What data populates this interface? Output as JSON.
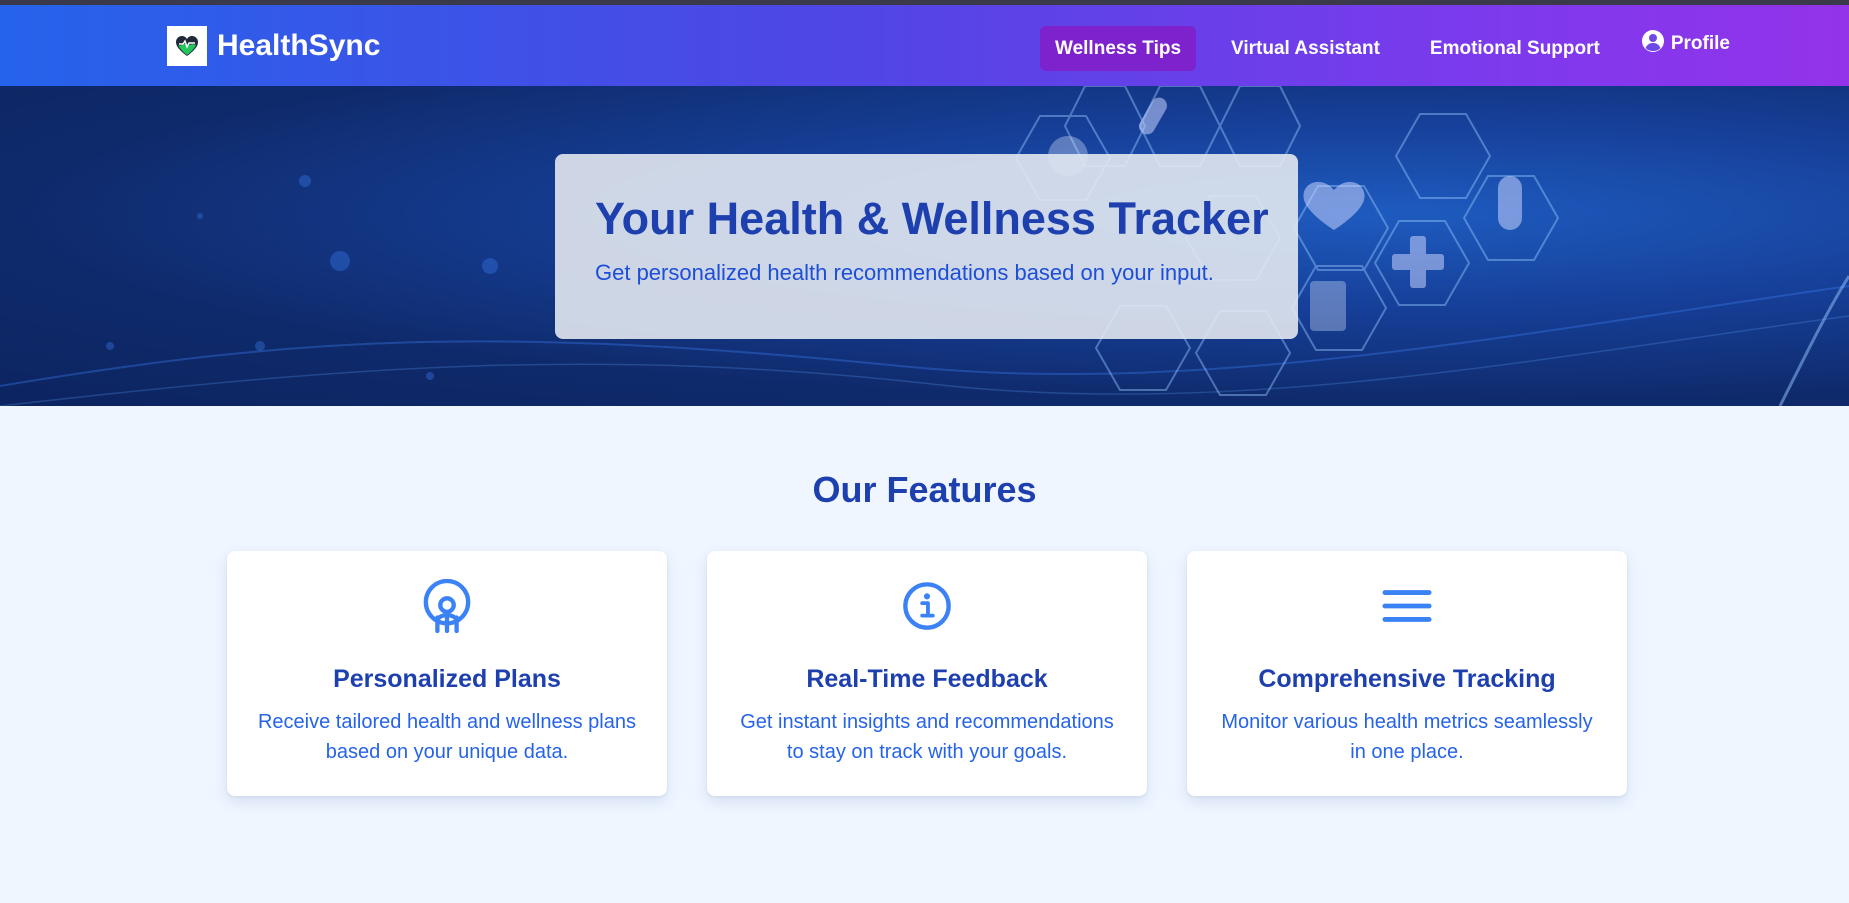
{
  "brand": {
    "name": "HealthSync",
    "logo_icon": "heart-logo-icon"
  },
  "nav": {
    "items": [
      {
        "label": "Wellness Tips",
        "active": true
      },
      {
        "label": "Virtual Assistant",
        "active": false
      },
      {
        "label": "Emotional Support",
        "active": false
      }
    ],
    "profile": {
      "label": "Profile",
      "icon": "user-circle-icon"
    }
  },
  "hero": {
    "title": "Your Health & Wellness Tracker",
    "subtitle": "Get personalized health recommendations based on your input."
  },
  "features": {
    "title": "Our Features",
    "items": [
      {
        "icon": "target-person-icon",
        "title": "Personalized Plans",
        "description": "Receive tailored health and wellness plans based on your unique data."
      },
      {
        "icon": "info-circle-icon",
        "title": "Real-Time Feedback",
        "description": "Get instant insights and recommendations to stay on track with your goals."
      },
      {
        "icon": "menu-lines-icon",
        "title": "Comprehensive Tracking",
        "description": "Monitor various health metrics seamlessly in one place."
      }
    ]
  },
  "colors": {
    "nav_gradient_start": "#2563eb",
    "nav_gradient_end": "#9333ea",
    "active_nav": "#7e22ce",
    "heading_blue": "#1e40af",
    "text_blue": "#2563eb",
    "icon_blue": "#3b82f6",
    "page_background": "#eff6ff"
  }
}
